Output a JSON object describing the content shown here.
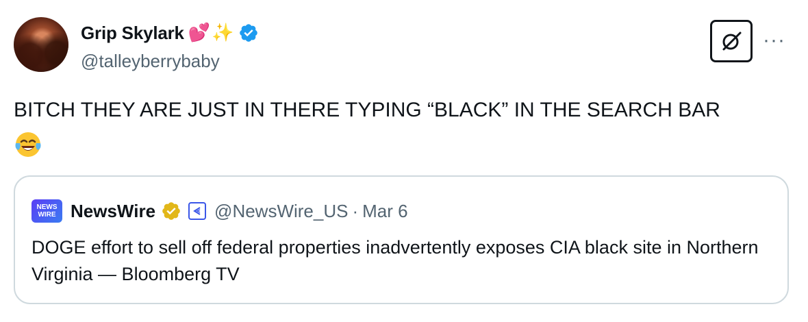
{
  "author": {
    "display_name": "Grip Skylark",
    "name_emojis": [
      "💕",
      "✨"
    ],
    "handle": "@talleyberrybaby",
    "verified_icon": "blue-verified-badge"
  },
  "actions": {
    "grok_icon": "grok-icon",
    "more_label": "···"
  },
  "tweet": {
    "text": "BITCH THEY ARE JUST IN THERE TYPING “BLACK” IN THE SEARCH BAR",
    "emoji": "😂"
  },
  "quote": {
    "logo_text_1": "NEWS",
    "logo_text_2": "WIRE",
    "display_name": "NewsWire",
    "verified_icon": "gold-verified-badge",
    "affiliate_icon": "affiliate-badge",
    "handle": "@NewsWire_US",
    "separator": "·",
    "date": "Mar 6",
    "text": "DOGE effort to sell off federal properties inadvertently exposes CIA black site in Northern Virginia — Bloomberg TV"
  },
  "colors": {
    "verified_blue": "#1d9bf0",
    "verified_gold": "#e2b719",
    "secondary_text": "#536471",
    "border": "#cfd9de"
  }
}
